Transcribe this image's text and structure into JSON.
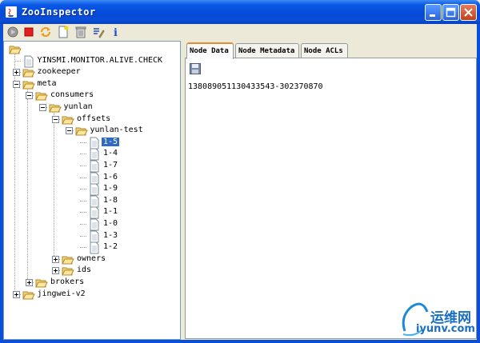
{
  "window": {
    "title": "ZooInspector"
  },
  "toolbar": {
    "icons": [
      "connect-icon",
      "disconnect-icon",
      "refresh-icon",
      "add-node-icon",
      "delete-node-icon",
      "edit-icon",
      "about-icon"
    ]
  },
  "tree": {
    "nodes": [
      {
        "label": "",
        "level": 0,
        "type": "folder"
      },
      {
        "label": "YINSMI.MONITOR.ALIVE.CHECK",
        "level": 1,
        "type": "file"
      },
      {
        "label": "zookeeper",
        "level": 1,
        "type": "folder",
        "expander": "plus"
      },
      {
        "label": "meta",
        "level": 1,
        "type": "folder",
        "expander": "minus"
      },
      {
        "label": "consumers",
        "level": 2,
        "type": "folder",
        "expander": "minus"
      },
      {
        "label": "yunlan",
        "level": 3,
        "type": "folder",
        "expander": "minus"
      },
      {
        "label": "offsets",
        "level": 4,
        "type": "folder",
        "expander": "minus"
      },
      {
        "label": "yunlan-test",
        "level": 5,
        "type": "folder",
        "expander": "minus"
      },
      {
        "label": "1-5",
        "level": 6,
        "type": "file",
        "selected": true
      },
      {
        "label": "1-4",
        "level": 6,
        "type": "file"
      },
      {
        "label": "1-7",
        "level": 6,
        "type": "file"
      },
      {
        "label": "1-6",
        "level": 6,
        "type": "file"
      },
      {
        "label": "1-9",
        "level": 6,
        "type": "file"
      },
      {
        "label": "1-8",
        "level": 6,
        "type": "file"
      },
      {
        "label": "1-1",
        "level": 6,
        "type": "file"
      },
      {
        "label": "1-0",
        "level": 6,
        "type": "file"
      },
      {
        "label": "1-3",
        "level": 6,
        "type": "file"
      },
      {
        "label": "1-2",
        "level": 6,
        "type": "file"
      },
      {
        "label": "owners",
        "level": 4,
        "type": "folder",
        "expander": "plus"
      },
      {
        "label": "ids",
        "level": 4,
        "type": "folder",
        "expander": "plus"
      },
      {
        "label": "brokers",
        "level": 2,
        "type": "folder",
        "expander": "plus"
      },
      {
        "label": "jingwei-v2",
        "level": 1,
        "type": "folder",
        "expander": "plus"
      }
    ]
  },
  "tabs": [
    {
      "label": "Node Data",
      "active": true
    },
    {
      "label": "Node Metadata",
      "active": false
    },
    {
      "label": "Node ACLs",
      "active": false
    }
  ],
  "node_data": {
    "value": "138089051130433543-302370870"
  },
  "watermark": {
    "text_cn": "运维网",
    "text_url": "iyunv.com"
  },
  "colors": {
    "titlebar": "#0a4fd7",
    "selection": "#316ac5",
    "active_tab_accent": "#e68b2c"
  }
}
